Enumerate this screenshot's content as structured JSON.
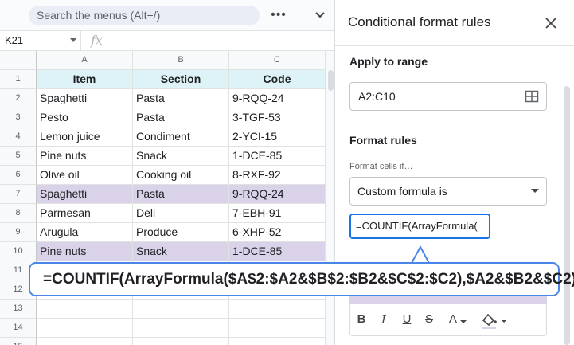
{
  "toolbar": {
    "search_placeholder": "Search the menus (Alt+/)",
    "more_icon": "more-horizontal-icon",
    "collapse_icon": "chevron-down-icon"
  },
  "formula_bar": {
    "name_box": "K21",
    "fx_label": "fx"
  },
  "sheet": {
    "columns": [
      "A",
      "B",
      "C"
    ],
    "header_row": {
      "num": "1",
      "cells": [
        "Item",
        "Section",
        "Code"
      ]
    },
    "rows": [
      {
        "num": "2",
        "cells": [
          "Spaghetti",
          "Pasta",
          "9-RQQ-24"
        ]
      },
      {
        "num": "3",
        "cells": [
          "Pesto",
          "Pasta",
          "3-TGF-53"
        ]
      },
      {
        "num": "4",
        "cells": [
          "Lemon juice",
          "Condiment",
          "2-YCI-15"
        ]
      },
      {
        "num": "5",
        "cells": [
          "Pine nuts",
          "Snack",
          "1-DCE-85"
        ]
      },
      {
        "num": "6",
        "cells": [
          "Olive oil",
          "Cooking oil",
          "8-RXF-92"
        ]
      },
      {
        "num": "7",
        "cells": [
          "Spaghetti",
          "Pasta",
          "9-RQQ-24"
        ]
      },
      {
        "num": "8",
        "cells": [
          "Parmesan",
          "Deli",
          "7-EBH-91"
        ]
      },
      {
        "num": "9",
        "cells": [
          "Arugula",
          "Produce",
          "6-XHP-52"
        ]
      },
      {
        "num": "10",
        "cells": [
          "Pine nuts",
          "Snack",
          "1-DCE-85"
        ]
      },
      {
        "num": "11",
        "cells": [
          "",
          "",
          ""
        ]
      },
      {
        "num": "12",
        "cells": [
          "",
          "",
          ""
        ]
      },
      {
        "num": "13",
        "cells": [
          "",
          "",
          ""
        ]
      },
      {
        "num": "14",
        "cells": [
          "",
          "",
          ""
        ]
      },
      {
        "num": "15",
        "cells": [
          "",
          "",
          ""
        ]
      }
    ],
    "highlight_color": "#d9d2e9",
    "header_fill": "#ddf3f8"
  },
  "panel": {
    "title": "Conditional format rules",
    "close_icon": "close-icon",
    "apply_label": "Apply to range",
    "range_value": "A2:C10",
    "range_icon": "grid-select-icon",
    "rules_label": "Format rules",
    "cells_if_label": "Format cells if…",
    "condition_value": "Custom formula is",
    "formula_value": "=COUNTIF(ArrayFormula(",
    "format_buttons": [
      "B",
      "I",
      "U",
      "S",
      "A"
    ]
  },
  "callout": {
    "text": "=COUNTIF(ArrayFormula($A$2:$A2&$B$2:$B2&$C$2:$C2),$A2&$B2&$C2)>1",
    "border_color": "#4a86e8"
  }
}
